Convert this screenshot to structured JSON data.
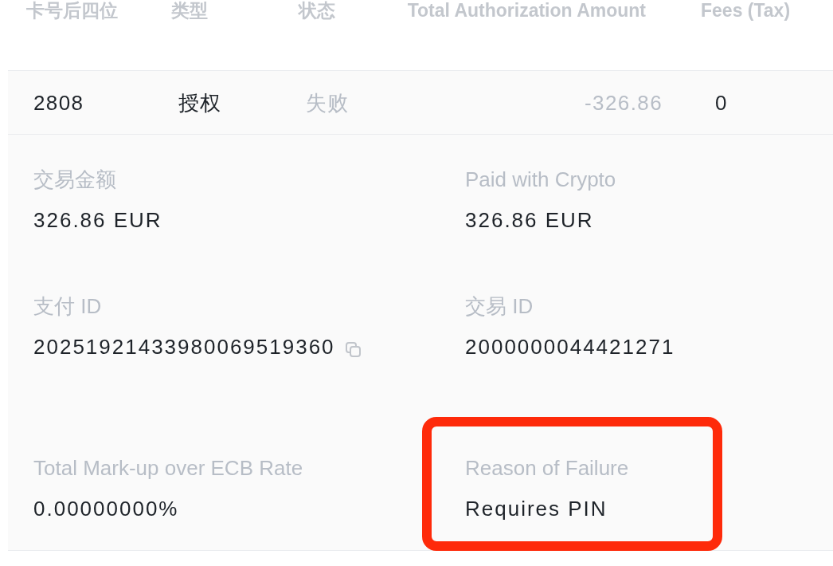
{
  "table": {
    "columns": [
      "卡号后四位",
      "类型",
      "状态",
      "Total Authorization Amount",
      "Fees (Tax)"
    ],
    "rows": [
      {
        "cells": [
          {
            "text": "2808",
            "dimmed": false
          },
          {
            "text": "授权",
            "dimmed": false
          },
          {
            "text": "失败",
            "dimmed": true
          },
          {
            "text": "-326.86",
            "dimmed": true
          },
          {
            "text": "0",
            "dimmed": false
          }
        ]
      }
    ]
  },
  "details": [
    {
      "label": "交易金额",
      "value": "326.86 EUR",
      "copyable": false,
      "highlighted": false
    },
    {
      "label": "Paid with Crypto",
      "value": "326.86 EUR",
      "copyable": false,
      "highlighted": false
    },
    {
      "label": "支付 ID",
      "value": "20251921433980069519360",
      "copyable": true,
      "highlighted": false
    },
    {
      "label": "交易 ID",
      "value": "2000000044421271",
      "copyable": false,
      "highlighted": false
    },
    {
      "label": "Total Mark-up over ECB Rate",
      "value": "0.00000000%",
      "copyable": false,
      "highlighted": false
    },
    {
      "label": "Reason of Failure",
      "value": "Requires PIN",
      "copyable": false,
      "highlighted": true
    }
  ]
}
